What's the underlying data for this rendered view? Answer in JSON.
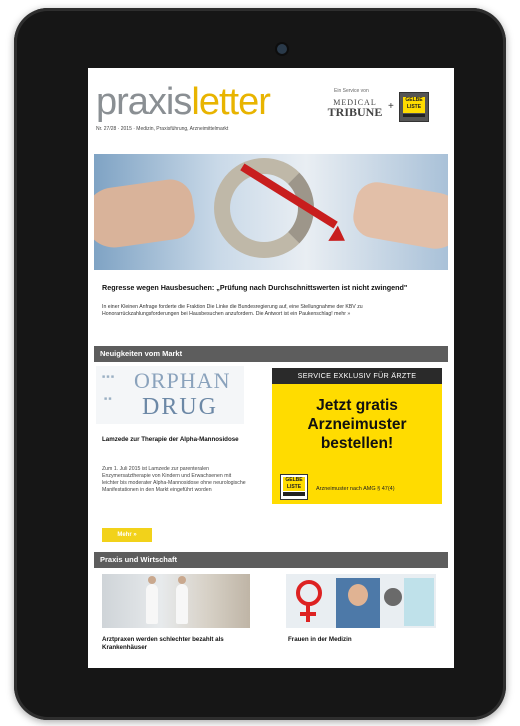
{
  "header": {
    "brand_part1": "praxis",
    "brand_part2": "letter",
    "issue_line": "Nr. 27/28 · 2015 · Medizin, Praxisführung, Arzneimittelmarkt",
    "partner_label": "Ein Service von",
    "partner_medical": "MEDICAL",
    "partner_tribune": "TRIBUNE",
    "plus": "+",
    "gelbe_liste": "GELBE LISTE"
  },
  "lead_article": {
    "title": "Regresse wegen Hausbesuchen: „Prüfung nach Durchschnittswerten ist nicht zwingend\"",
    "body": "In einer Kleinen Anfrage forderte die Fraktion Die Linke die Bundesregierung auf, eine Stellungnahme der KBV zu Honorarrückzahlungsforderungen bei Hausbesuchen anzufordern. Die Antwort ist ein Paukenschlag! mehr »"
  },
  "section_market": {
    "title": "Neuigkeiten vom Markt",
    "article": {
      "image_word1": "ORPHAN",
      "image_word2": "DRUG",
      "title": "Lamzede zur Therapie der Alpha-Mannosidose",
      "body": "Zum 1. Juli 2015 ist Lamzede zur parenteralen Enzymersatztherapie von Kindern und Erwachsenen mit leichter bis moderater Alpha-Mannosidose ohne neurologische Manifestationen in den Markt eingeführt worden",
      "button": "Mehr »"
    },
    "ad": {
      "header": "SERVICE EXKLUSIV FÜR ÄRZTE",
      "line1": "Jetzt gratis",
      "line2": "Arzneimuster",
      "line3": "bestellen!",
      "logo": "GELBE LISTE",
      "footer": "Arzneimuster nach AMG § 47(4)"
    }
  },
  "section_praxis": {
    "title": "Praxis und Wirtschaft",
    "articles": [
      {
        "title": "Arztpraxen werden schlechter bezahlt als Krankenhäuser"
      },
      {
        "title": "Frauen in der Medizin"
      }
    ]
  },
  "colors": {
    "accent_yellow": "#ffdc00",
    "section_bar": "#5d5d5d",
    "brand_grey": "#8a8f93",
    "arrow_red": "#c81e1e"
  }
}
